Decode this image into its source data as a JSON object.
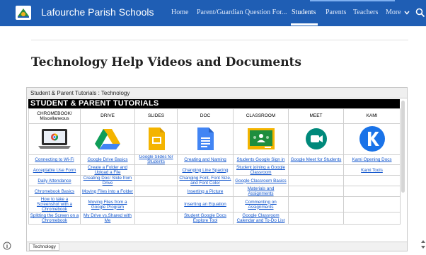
{
  "header": {
    "site_title": "Lafourche Parish Schools",
    "nav": [
      "Home",
      "Parent/Guardian Question For...",
      "Students",
      "Parents",
      "Teachers"
    ],
    "active_nav": "Students",
    "more_label": "More",
    "search_icon": "search-icon",
    "logo_icon": "district-logo-icon",
    "colors": {
      "bar": "#1f5eb4",
      "text": "#ffffff"
    }
  },
  "page": {
    "title": "Technology Help Videos and Documents"
  },
  "embed": {
    "header_label": "Student & Parent Tutorials : Technology",
    "sheet_title": "STUDENT & PARENT TUTORIALS",
    "columns": [
      {
        "label": "CHROMEBOOK/ Miscellaneous",
        "icon": "chromebook-icon"
      },
      {
        "label": "DRIVE",
        "icon": "google-drive-icon"
      },
      {
        "label": "SLIDES",
        "icon": "google-slides-icon"
      },
      {
        "label": "DOC",
        "icon": "google-docs-icon"
      },
      {
        "label": "CLASSROOM",
        "icon": "google-classroom-icon"
      },
      {
        "label": "MEET",
        "icon": "google-meet-icon"
      },
      {
        "label": "KAMI",
        "icon": "kami-icon"
      }
    ],
    "rows": [
      [
        "Connecting to Wi-Fi",
        "Google Drive Basics",
        "Google Slides for Students",
        "Creating and Naming",
        "Students Google Sign in",
        "Google Meet for Students",
        "Kami Opening Docs"
      ],
      [
        "Acceptable Use Form",
        "Create a Folder and Upload a File",
        "",
        "Changing Line Spacing",
        "Student joining a Google Classroom",
        "",
        "Kami Tools"
      ],
      [
        "Daily Attendance",
        "Creating Doc/ Slide from Drive",
        "",
        "Changing Font, Font Size, and Font Color",
        "Google Classroom Basics",
        "",
        ""
      ],
      [
        "Chromebook Basics",
        "Moving Files into a Folder",
        "",
        "Inserting a Picture",
        "Materials and Assignments",
        "",
        ""
      ],
      [
        "How to take a Screenshot with a Chromebook",
        "Moving Files from a Google Program",
        "",
        "Inserting an Equation",
        "Commenting on Assignments",
        "",
        ""
      ],
      [
        "Splitting the Screen on a Chromebook",
        "My Drive vs.Shared with Me",
        "",
        "Student Google Docs Explore Tool",
        "Google Classroom Calendar and To-Do List",
        "",
        ""
      ]
    ],
    "sheet_tab": "Technology"
  }
}
